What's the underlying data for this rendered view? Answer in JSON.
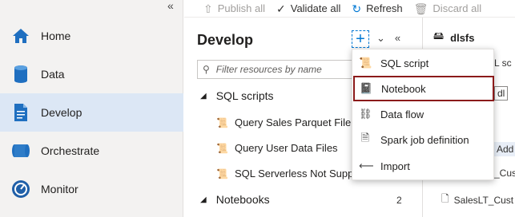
{
  "nav": {
    "collapse_glyph": "«",
    "items": [
      {
        "label": "Home",
        "icon": "home-icon"
      },
      {
        "label": "Data",
        "icon": "database-icon"
      },
      {
        "label": "Develop",
        "icon": "document-icon",
        "active": true
      },
      {
        "label": "Orchestrate",
        "icon": "pipeline-icon"
      },
      {
        "label": "Monitor",
        "icon": "gauge-icon"
      }
    ]
  },
  "toolbar": {
    "publish_all": "Publish all",
    "validate_all": "Validate all",
    "refresh": "Refresh",
    "discard_all": "Discard all"
  },
  "develop": {
    "title": "Develop",
    "filter_placeholder": "Filter resources by name",
    "sections": [
      {
        "label": "SQL scripts",
        "count": ""
      },
      {
        "label": "Notebooks",
        "count": "2"
      }
    ],
    "files": [
      "Query Sales Parquet File",
      "Query User Data Files",
      "SQL Serverless Not Supported"
    ]
  },
  "menu": {
    "items": [
      {
        "label": "SQL script",
        "icon": "sql-script-icon"
      },
      {
        "label": "Notebook",
        "icon": "notebook-icon",
        "highlighted": true
      },
      {
        "label": "Data flow",
        "icon": "dataflow-icon"
      },
      {
        "label": "Spark job definition",
        "icon": "spark-job-icon"
      },
      {
        "label": "Import",
        "icon": "import-icon"
      }
    ]
  },
  "right": {
    "workspace": "dlsfs",
    "frag_sql": "L sc",
    "frag_dl": "dl",
    "frag_add": "Add",
    "frag_cust": "_Cust",
    "file": "SalesLT_Cust"
  },
  "colors": {
    "accent": "#0078d4",
    "highlight_border": "#8b1a1a",
    "active_nav": "#dce7f5"
  }
}
